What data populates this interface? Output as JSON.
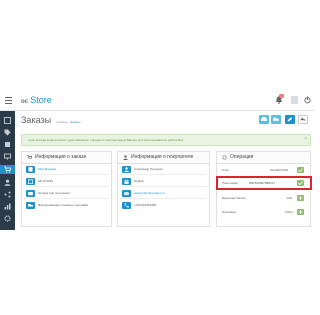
{
  "header": {
    "logo_prefix": "oc",
    "logo_name": "Store",
    "notification_count": "1"
  },
  "page": {
    "title": "Заказы",
    "breadcrumb": [
      "Главная",
      "Заказы"
    ]
  },
  "alert": {
    "text": "Срок выхода водительского удостоверения: порядок о Срок выхода добавлен для использования в работе Вот.",
    "close": "×"
  },
  "order_panel": {
    "title": "Информация о заказе",
    "rows": [
      "Мой Магазин",
      "28.12.2015",
      "Оплата при получении",
      "Фиксированная стоимость доставки"
    ]
  },
  "customer_panel": {
    "title": "Информация о покупателе",
    "rows": [
      "Александр Тестеров",
      "Default",
      "tester.bitrix@yandex.ru",
      "+7(912)3334455"
    ]
  },
  "operations_panel": {
    "title": "Операции",
    "rows": [
      {
        "label": "Счёт",
        "value": "INV-2015-001"
      },
      {
        "label": "Трек-номер",
        "value": "RB251089789RCN"
      },
      {
        "label": "Бонусные баллы",
        "value": "100"
      },
      {
        "label": "Партнёры",
        "value": "0.00 р."
      }
    ]
  },
  "colors": {
    "accent": "#1e91cf",
    "sidebar": "#2b3a48",
    "success": "#8fbb6c",
    "highlight": "#d7262f"
  }
}
